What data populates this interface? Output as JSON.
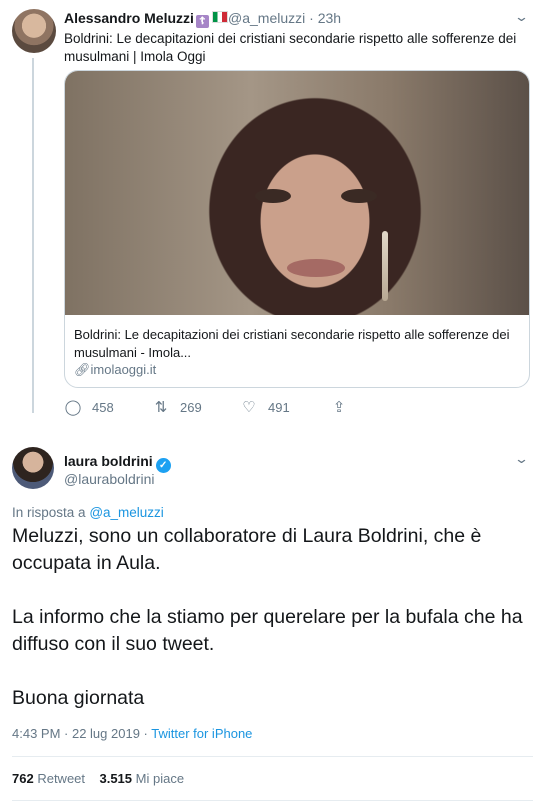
{
  "tweet1": {
    "author_name": "Alessandro Meluzzi",
    "badge_glyph": "☦",
    "handle": "@a_meluzzi",
    "time": "23h",
    "text": "Boldrini: Le decapitazioni dei cristiani secondarie rispetto alle sofferenze dei musulmani | Imola Oggi",
    "card": {
      "title": "Boldrini: Le decapitazioni dei cristiani secondarie rispetto alle sofferenze dei musulmani - Imola...",
      "domain": "imolaoggi.it"
    },
    "replies": "458",
    "retweets": "269",
    "likes": "491"
  },
  "tweet2": {
    "author_name": "laura boldrini",
    "handle": "@lauraboldrini",
    "reply_prefix": "In risposta a",
    "reply_to": "@a_meluzzi",
    "paragraphs": [
      "Meluzzi, sono un collaboratore di Laura Boldrini, che è occupata in Aula.",
      "La informo che la stiamo per querelare per la bufala che ha diffuso con il suo tweet.",
      "Buona giornata"
    ],
    "timestamp": "4:43 PM · 22 lug 2019 ·",
    "source": "Twitter for iPhone",
    "retweet_count": "762",
    "retweet_label": "Retweet",
    "like_count": "3.515",
    "like_label": "Mi piace"
  },
  "icons": {
    "reply": "reply-icon",
    "retweet": "retweet-icon",
    "like": "heart-icon",
    "share": "share-icon",
    "more": "chevron-down-icon"
  },
  "colors": {
    "link": "#1b95e0",
    "muted": "#657786",
    "verified": "#1da1f2"
  }
}
